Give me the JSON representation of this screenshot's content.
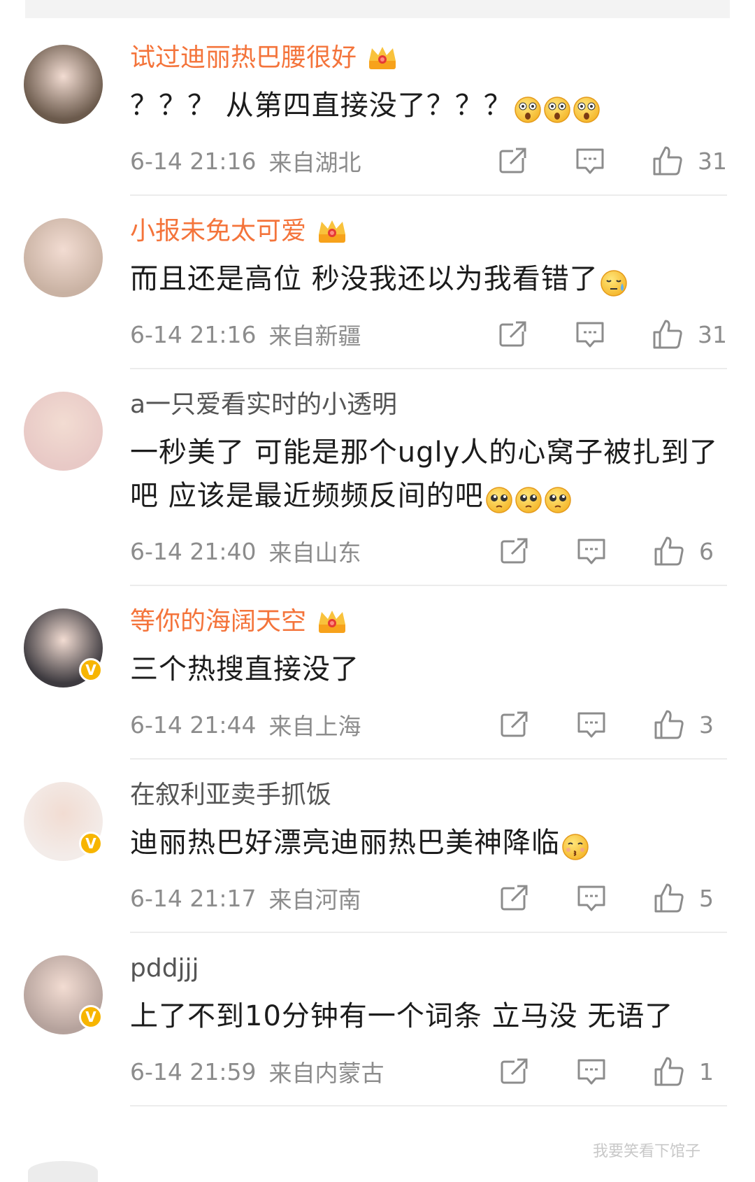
{
  "comments": [
    {
      "username": "试过迪丽热巴腰很好",
      "vip": true,
      "verified": false,
      "avatar_color": "#6b5a4c",
      "text": "？？？ 从第四直接没了？？？",
      "emojis": [
        "shocked-emoji",
        "shocked-emoji",
        "shocked-emoji"
      ],
      "time": "6-14 21:16",
      "location": "来自湖北",
      "likes": "31"
    },
    {
      "username": "小报未免太可爱",
      "vip": true,
      "verified": false,
      "avatar_color": "#c9b2a3",
      "text": "而且还是高位 秒没我还以为我看错了",
      "emojis": [
        "sweat-emoji"
      ],
      "time": "6-14 21:16",
      "location": "来自新疆",
      "likes": "31"
    },
    {
      "username": "a一只爱看实时的小透明",
      "vip": false,
      "verified": false,
      "avatar_color": "#e8c9c6",
      "text": "一秒美了 可能是那个ugly人的心窝子被扎到了吧 应该是最近频频反间的吧",
      "emojis": [
        "pleading-emoji",
        "pleading-emoji",
        "pleading-emoji"
      ],
      "time": "6-14 21:40",
      "location": "来自山东",
      "likes": "6"
    },
    {
      "username": "等你的海阔天空",
      "vip": true,
      "verified": true,
      "avatar_color": "#3d3a3f",
      "text": "三个热搜直接没了",
      "emojis": [],
      "time": "6-14 21:44",
      "location": "来自上海",
      "likes": "3"
    },
    {
      "username": "在叙利亚卖手抓饭",
      "vip": false,
      "verified": true,
      "avatar_color": "#f3ece9",
      "text": "迪丽热巴好漂亮迪丽热巴美神降临",
      "emojis": [
        "kiss-emoji"
      ],
      "time": "6-14 21:17",
      "location": "来自河南",
      "likes": "5"
    },
    {
      "username": "pddjjj",
      "vip": false,
      "verified": true,
      "avatar_color": "#b5a29c",
      "text": "上了不到10分钟有一个词条 立马没 无语了",
      "emojis": [],
      "time": "6-14 21:59",
      "location": "来自内蒙古",
      "likes": "1"
    }
  ],
  "icons": {
    "share": "share-icon",
    "reply": "comment-icon",
    "like": "thumbs-up-icon",
    "vip": "crown-icon",
    "verified": "v-badge-icon"
  },
  "colors": {
    "vip_name": "#f4743b",
    "plain_name": "#555555",
    "meta": "#8c8c8c",
    "verified_badge": "#f7b500"
  },
  "verified_badge_text": "V",
  "watermark": "我要笑看下馆子"
}
